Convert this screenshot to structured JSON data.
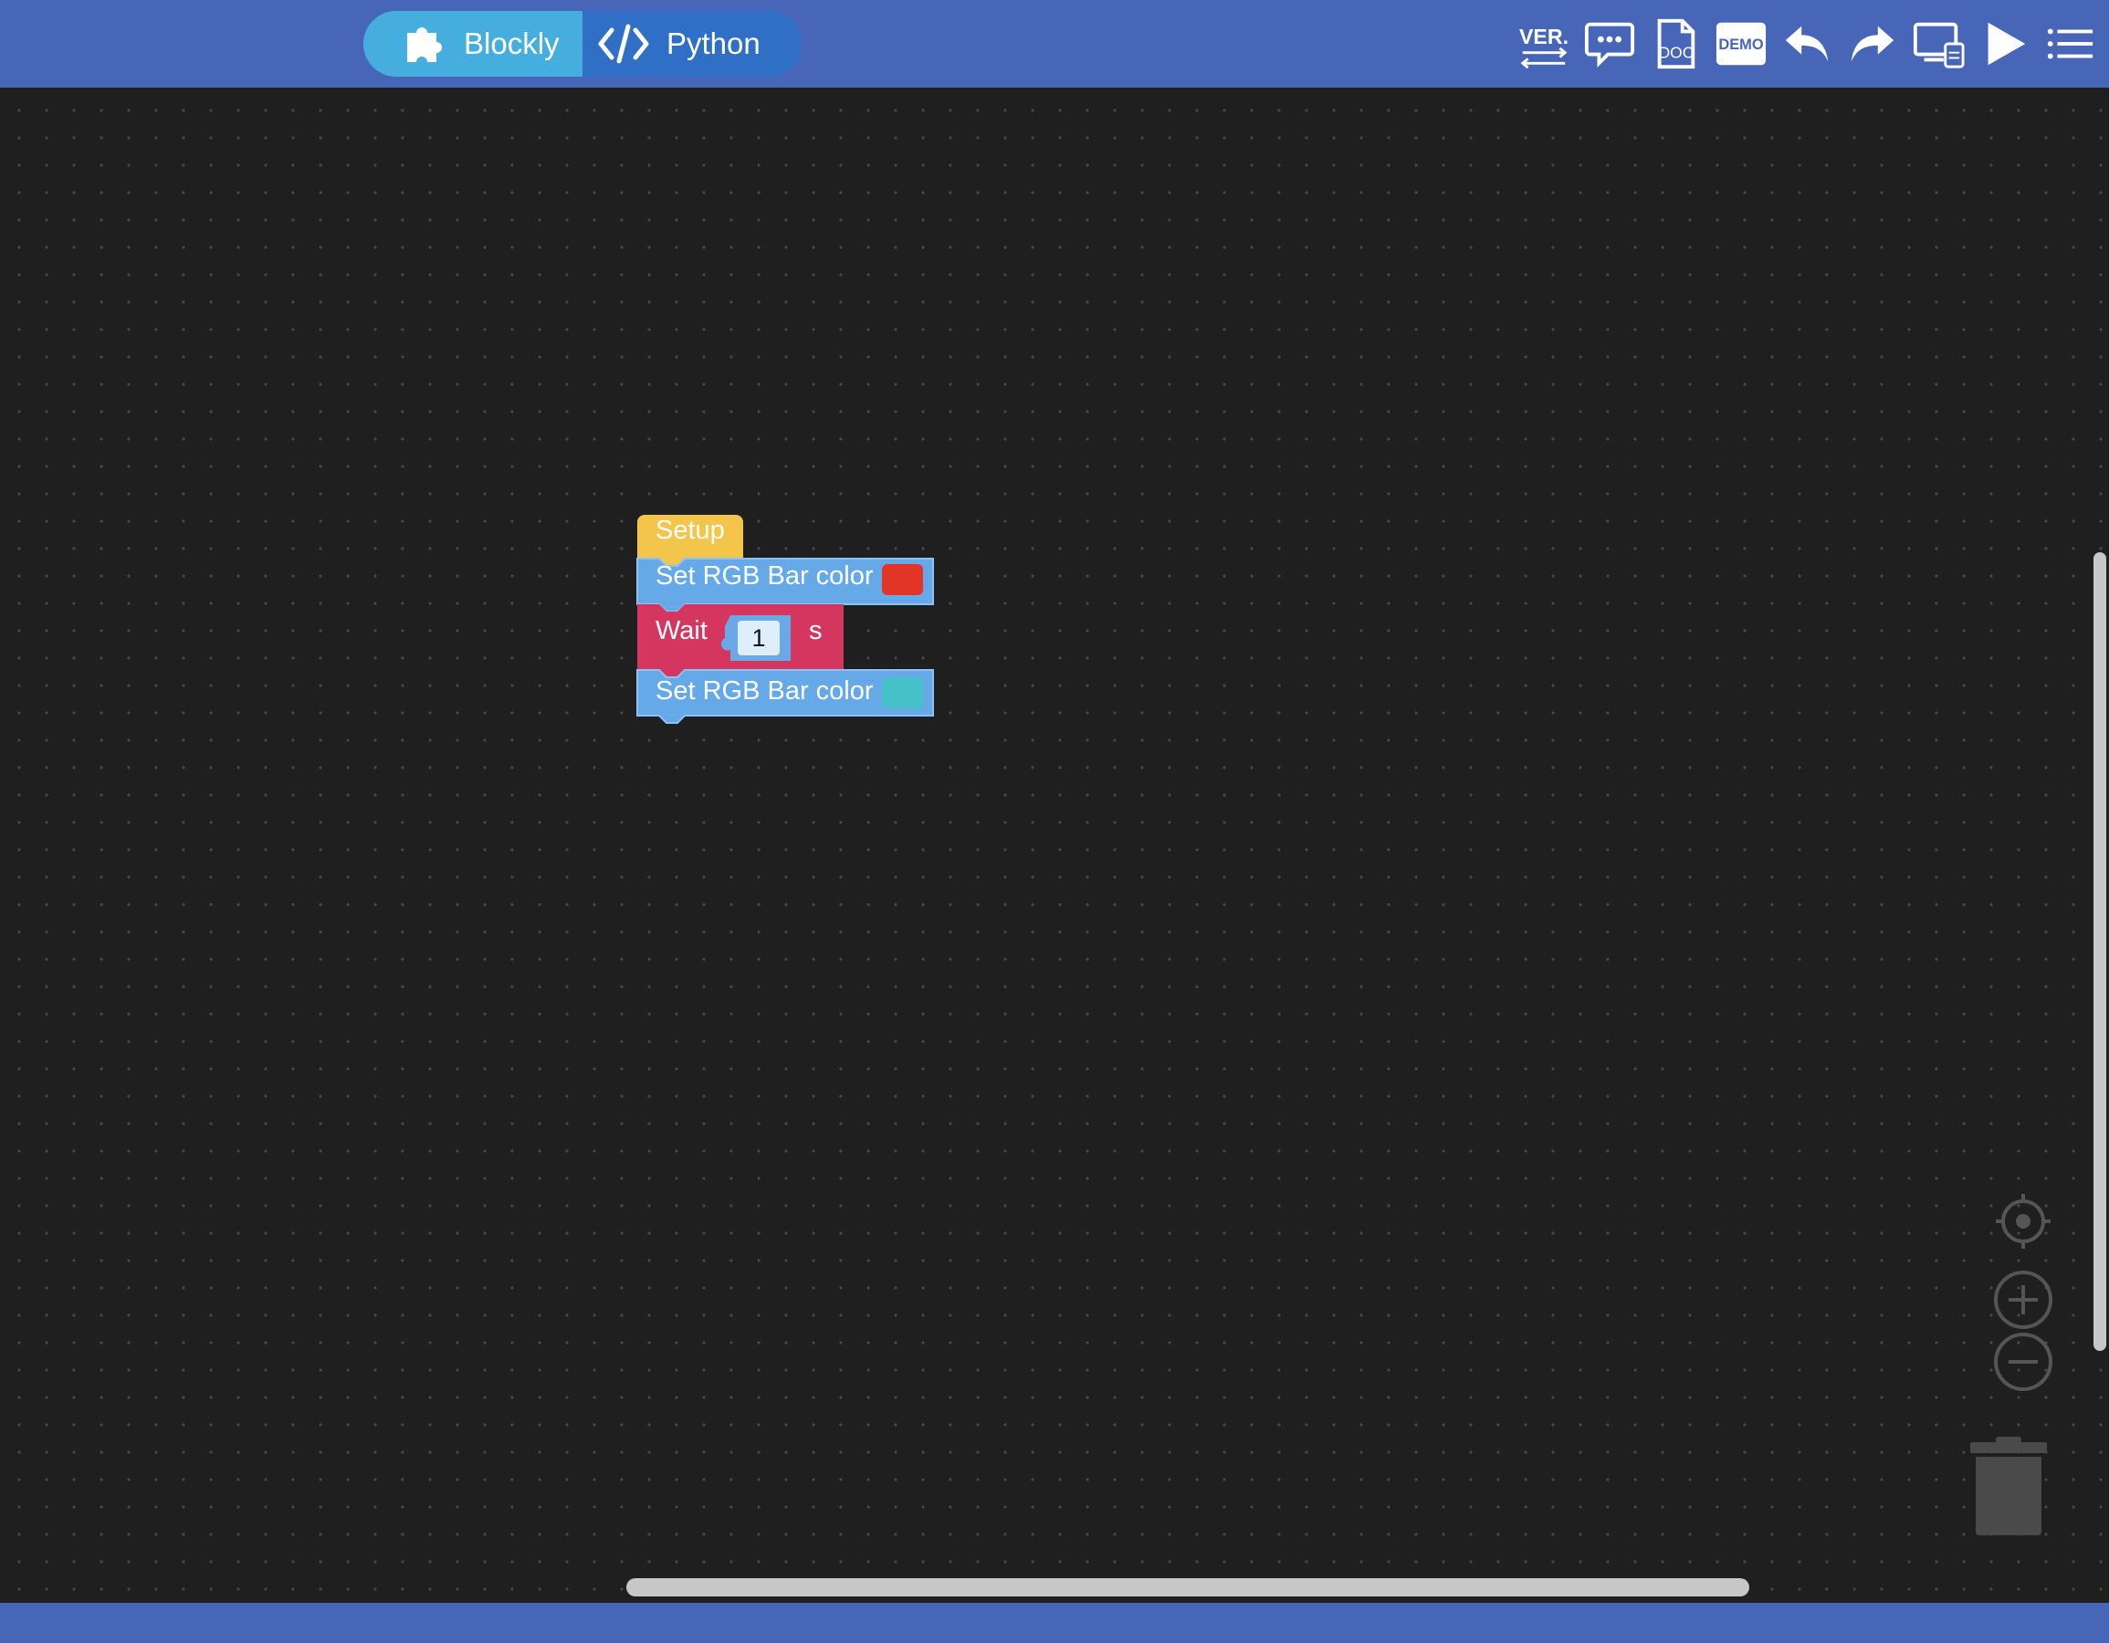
{
  "header": {
    "modes": [
      {
        "label": "Blockly",
        "icon": "puzzle-icon"
      },
      {
        "label": "Python",
        "icon": "code-icon"
      }
    ],
    "toolbar": [
      {
        "name": "version-icon",
        "text": "VER."
      },
      {
        "name": "comment-icon"
      },
      {
        "name": "doc-icon",
        "text": "DOC"
      },
      {
        "name": "demo-icon",
        "text": "DEMO"
      },
      {
        "name": "undo-icon"
      },
      {
        "name": "redo-icon"
      },
      {
        "name": "device-icon"
      },
      {
        "name": "run-icon"
      },
      {
        "name": "menu-icon"
      }
    ]
  },
  "blocks": {
    "setup": {
      "label": "Setup",
      "color": "#f4c54b"
    },
    "set_rgb_1": {
      "label": "Set RGB Bar color",
      "swatch": "#e33428",
      "color": "#66a9e8"
    },
    "wait": {
      "label": "Wait",
      "value": "1",
      "unit": "s",
      "color": "#d4365f"
    },
    "set_rgb_2": {
      "label": "Set RGB Bar color",
      "swatch": "#46c0c9",
      "color": "#66a9e8"
    }
  },
  "workspace_controls": [
    "recenter-icon",
    "zoom-in-icon",
    "zoom-out-icon",
    "trash-icon"
  ],
  "colors": {
    "header": "#4866b8",
    "workspace": "#1f1f1f"
  }
}
